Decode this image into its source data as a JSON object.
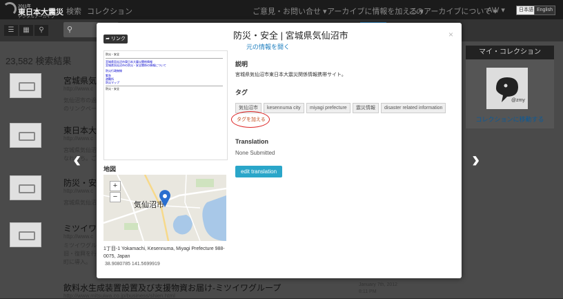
{
  "logo": {
    "line1": "2011年",
    "line2": "東日本大震災",
    "line3": "デジタルアーカイブ"
  },
  "nav": {
    "search": "検索",
    "collection": "コレクション",
    "contact": "ご意見・お問い合せ ▾",
    "add_archive": "アーカイブに情報を加える ▾",
    "about": "このアーカイブについて ▾",
    "user": "AW ▾",
    "lang_ja": "日本語",
    "lang_en": "English"
  },
  "results": {
    "count": "23,582 検索結果",
    "items": [
      {
        "title": "宮城県気",
        "url": "http://www.c",
        "desc1": "気仙沼市の過",
        "desc2": "のリンクペー"
      },
      {
        "title": "東日本大",
        "url": "http://www.c",
        "desc1": "宮城県気仙沼",
        "desc2": "なれたち。ご"
      },
      {
        "title": "防災・安全",
        "url": "http://www.c",
        "desc1": "宮城県気仙沼",
        "desc2": ""
      },
      {
        "title": "ミツイワク",
        "url": "http://www.c",
        "desc1": "ミツイワグル",
        "desc2": "旧・復興を行",
        "desc3": "町に導入。"
      }
    ],
    "bottom_title": "飲料水生成装置設置及び支援物資お届け-ミツイワグループ",
    "bottom_url": "http://www.mitsuiwa.co.jp/business/shien.html",
    "bottom_date": "January 7th, 2012",
    "bottom_time": "8:11 PM"
  },
  "my_collection": {
    "header": "マイ・コレクション",
    "username": "@zmy",
    "link": "コレクションに移動する"
  },
  "modal": {
    "link_button": "リンク",
    "title": "防災・安全 | 宮城県気仙沼市",
    "open_source": "元の情報を開く",
    "description_label": "説明",
    "description": "宮城県気仙沼市東日本大震災関係情報携帯サイト。",
    "tags_label": "タグ",
    "tags": [
      "気仙沼市",
      "kesennuma city",
      "miyagi prefecture",
      "震災情報",
      "disaster related information"
    ],
    "add_tag": "タグを加える",
    "translation_label": "Translation",
    "translation_value": "None Submitted",
    "edit_translation": "edit translation",
    "map_label": "地図",
    "map_city": "気仙沼市",
    "zoom_in": "+",
    "zoom_out": "−",
    "address": "1丁目-1 Yokamachi, Kesennuma, Miyagi Prefecture 988-0075, Japan",
    "coordinates": "38.9080785 141.5699919",
    "preview": {
      "header": "防災・安全",
      "lines": [
        "宮城県気仙沼市東日本大震災関係情報",
        "宮城県気仙沼市の防災・安全関係の情報について",
        "防災行政無線",
        "緊急",
        "避難所",
        "防災マップ",
        "防災・安全"
      ]
    }
  }
}
